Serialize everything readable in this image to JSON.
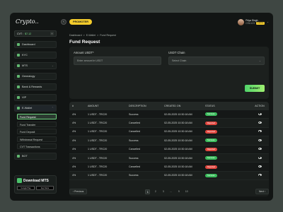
{
  "app": {
    "logo": "Crypto..",
    "collapse_icon": "‹"
  },
  "sidebar": {
    "cvt_label": "CVT :",
    "cvt_value": "$7.12",
    "items": [
      {
        "label": "Dashboard"
      },
      {
        "label": "KYC"
      },
      {
        "label": "MTS"
      },
      {
        "label": "Genealogy"
      },
      {
        "label": "Bank & Rewards"
      },
      {
        "label": "VIP"
      },
      {
        "label": "E-Wallet"
      }
    ],
    "ewallet_sub": [
      {
        "label": "Fund Request"
      },
      {
        "label": "Fund Transfer"
      },
      {
        "label": "Fund Deposit"
      },
      {
        "label": "Withdrawal Request"
      },
      {
        "label": "CVT Transactions"
      }
    ],
    "bot": "BOT",
    "download_title": "Download MTS",
    "store_google": "Google Play",
    "store_apple": "App Store"
  },
  "topbar": {
    "promoter": "PROMOTER",
    "user_name": "Priya Singh",
    "user_id": "CSU123",
    "user_status": "Inactive"
  },
  "breadcrumb": [
    "Dashboard",
    ">",
    "E-Wallet",
    ">",
    "Fund Request"
  ],
  "page_title": "Fund Request",
  "form": {
    "amount_label": "Amount USDT*",
    "amount_placeholder": "Enter amount in USDT",
    "chain_label": "USDT Chain",
    "chain_placeholder": "Select Chain",
    "submit": "SUBMIT"
  },
  "table": {
    "headers": [
      "#",
      "AMOUNT",
      "DESCRIPTION",
      "CREATED ON",
      "STATUS",
      "ACTION"
    ],
    "rows": [
      {
        "id": "4%",
        "amount": "1 USDT - TRC20",
        "description": "Success",
        "created": "02-05-2025 10:30:18 AM",
        "status": "Success"
      },
      {
        "id": "4%",
        "amount": "1 USDT - TRC20",
        "description": "Cancelled",
        "created": "02-05-2025 10:30:18 AM",
        "status": "Rejected"
      },
      {
        "id": "4%",
        "amount": "1 USDT - TRC20",
        "description": "Cancelled",
        "created": "02-05-2025 10:30:18 AM",
        "status": "Rejected"
      },
      {
        "id": "4%",
        "amount": "1 USDT - TRC20",
        "description": "Success",
        "created": "02-05-2025 10:30:18 AM",
        "status": "Success"
      },
      {
        "id": "4%",
        "amount": "1 USDT - TRC20",
        "description": "Cancelled",
        "created": "02-05-2025 10:30:18 AM",
        "status": "Rejected"
      },
      {
        "id": "4%",
        "amount": "1 USDT - TRC20",
        "description": "Success",
        "created": "02-05-2025 10:30:18 AM",
        "status": "Success"
      },
      {
        "id": "4%",
        "amount": "1 USDT - TRC20",
        "description": "Cancelled",
        "created": "02-05-2025 10:30:18 AM",
        "status": "Rejected"
      },
      {
        "id": "4%",
        "amount": "1 USDT - TRC20",
        "description": "Success",
        "created": "02-05-2025 10:30:18 AM",
        "status": "Success"
      }
    ]
  },
  "pagination": {
    "prev": "‹ Previous",
    "next": "Next ›",
    "pages": [
      "1",
      "2",
      "3",
      "...",
      "9",
      "10"
    ],
    "active_page": "1"
  },
  "colors": {
    "accent": "#6fd37f",
    "promoter": "#f4cc2c",
    "success": "#3bbd5c",
    "rejected": "#e2473f"
  }
}
